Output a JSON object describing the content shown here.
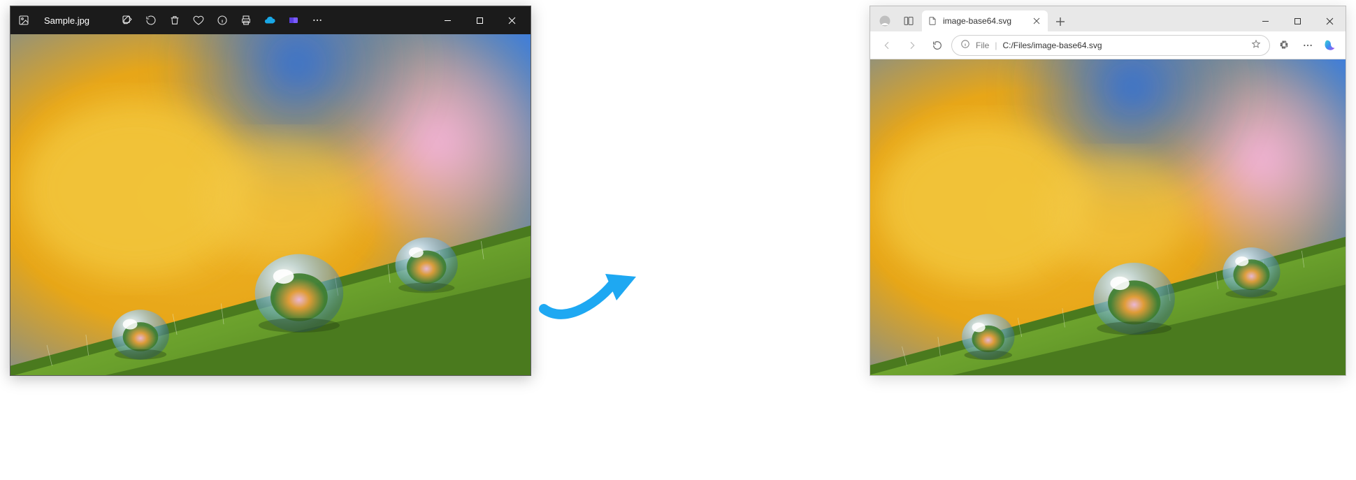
{
  "photos": {
    "filename": "Sample.jpg",
    "toolbar": {
      "edit": "edit-icon",
      "rotate": "rotate-icon",
      "delete": "delete-icon",
      "favorite": "heart-icon",
      "info": "info-icon",
      "print": "print-icon",
      "cloud": "onedrive-icon",
      "clipchamp": "clipchamp-icon",
      "more": "more-icon"
    },
    "window": {
      "min": "–",
      "max": "▢",
      "close": "✕"
    }
  },
  "edge": {
    "tab": {
      "title": "image-base64.svg"
    },
    "addressbar": {
      "scheme_label": "File",
      "path": "C:/Files/image-base64.svg"
    },
    "window": {
      "min": "–",
      "max": "▢",
      "close": "✕"
    }
  },
  "colors": {
    "arrow": "#1ea8f2",
    "photos_bg": "#1b1b1b",
    "edge_chrome": "#e8e8e8"
  }
}
